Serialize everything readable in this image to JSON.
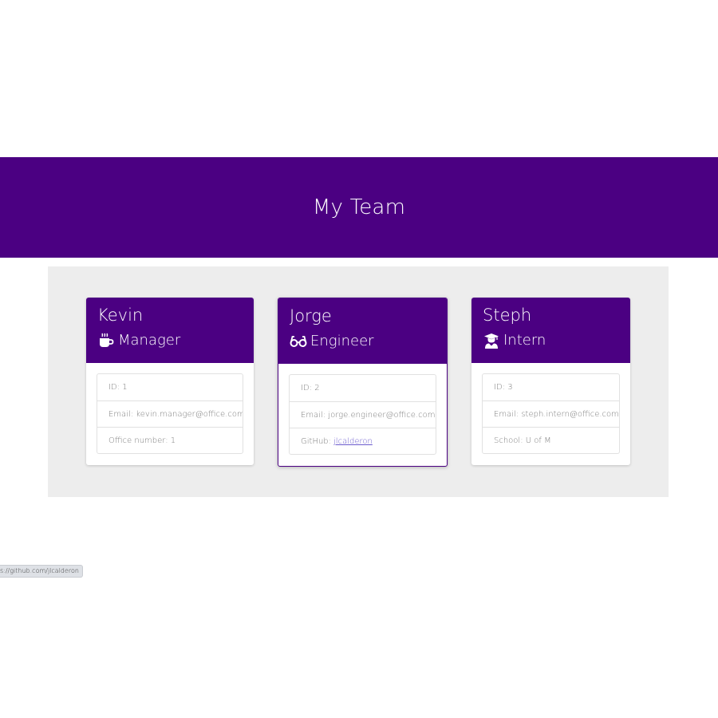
{
  "header": {
    "title": "My Team"
  },
  "team": [
    {
      "name": "Kevin",
      "role": "Manager",
      "role_icon": "coffee-mug-icon",
      "details": [
        {
          "label": "ID:",
          "value": "1"
        },
        {
          "label": "Email:",
          "value": "kevin.manager@office.com"
        },
        {
          "label": "Office number:",
          "value": "1"
        }
      ]
    },
    {
      "name": "Jorge",
      "role": "Engineer",
      "role_icon": "glasses-icon",
      "details": [
        {
          "label": "ID:",
          "value": "2"
        },
        {
          "label": "Email:",
          "value": "jorge.engineer@office.com"
        },
        {
          "label": "GitHub:",
          "value": "jlcalderon"
        }
      ]
    },
    {
      "name": "Steph",
      "role": "Intern",
      "role_icon": "graduate-icon",
      "details": [
        {
          "label": "ID:",
          "value": "3"
        },
        {
          "label": "Email:",
          "value": "steph.intern@office.com"
        },
        {
          "label": "School:",
          "value": "U of M"
        }
      ]
    }
  ],
  "status_bar": {
    "url": "s://github.com/jlcalderon"
  },
  "colors": {
    "primary": "#4b0082",
    "background_panel": "#ededed",
    "link": "#6a5acd"
  }
}
